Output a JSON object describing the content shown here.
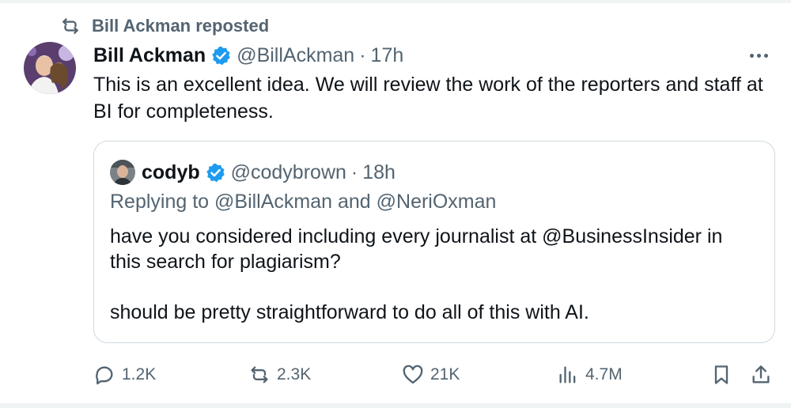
{
  "repost": {
    "label": "Bill Ackman reposted"
  },
  "tweet": {
    "author_name": "Bill Ackman",
    "handle": "@BillAckman",
    "separator": "·",
    "time": "17h",
    "text": "This is an excellent idea. We will review the work of the reporters and staff at BI for completeness."
  },
  "quote": {
    "author_name": "codyb",
    "handle": "@codybrown",
    "separator": "·",
    "time": "18h",
    "replying_to": "Replying to @BillAckman and @NeriOxman",
    "paragraph_1": "have you considered including every journalist at @BusinessInsider in this search for plagiarism?",
    "paragraph_2": "should be pretty straightforward to do all of this with AI."
  },
  "actions": {
    "replies": "1.2K",
    "reposts": "2.3K",
    "likes": "21K",
    "views": "4.7M"
  },
  "icons": {
    "repost_header": "repost-icon",
    "verified": "verified-badge-icon",
    "more": "more-icon",
    "reply": "reply-icon",
    "repost": "repost-icon",
    "like": "heart-icon",
    "views": "views-icon",
    "bookmark": "bookmark-icon",
    "share": "share-icon"
  },
  "colors": {
    "text": "#0f1419",
    "secondary": "#536471",
    "verified": "#1d9bf0",
    "border": "#cfd9de"
  }
}
